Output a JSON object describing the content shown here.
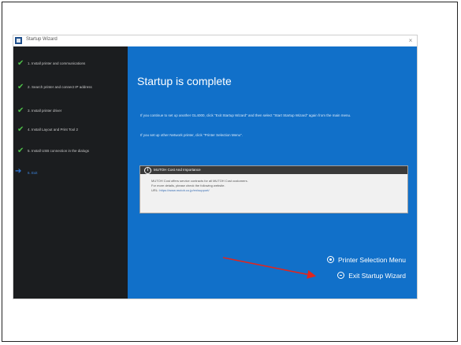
{
  "window": {
    "title": "Startup Wizard",
    "close_glyph": "×"
  },
  "sidebar": {
    "steps": [
      {
        "label": "1. Install printer and communications",
        "state": "done"
      },
      {
        "label": "2. Search printer and connect IP address",
        "state": "done"
      },
      {
        "label": "3. Install printer driver",
        "state": "done"
      },
      {
        "label": "4. Install Layout and Print Tool 2",
        "state": "done"
      },
      {
        "label": "5. Install USB connection in the dialogs",
        "state": "done"
      },
      {
        "label": "6. Exit",
        "state": "current"
      }
    ]
  },
  "main": {
    "title": "Startup is complete",
    "para1": "If you continue to set up another GL4000, click \"Exit Startup Wizard\" and then select \"Start Startup Wizard\" again from the main menu.",
    "para2": "If you set up other Network printer, click \"Printer Selection Menu\"."
  },
  "info": {
    "title": "MUTOH Cost And Importance",
    "lines": [
      "MUTOH Cost offers service contracts for all MUTOH Cost customers.",
      "For more details, please check the following website."
    ],
    "url_label": "URL:",
    "url": "https://www.mutoh.co.jp/en/support/"
  },
  "actions": {
    "printer_selection_label": "Printer Selection Menu",
    "exit_label": "Exit Startup Wizard"
  },
  "colors": {
    "main_bg": "#1170c9",
    "sidebar_bg": "#1b1d1f",
    "check": "#4fc14a",
    "annotation_arrow": "#e0261e"
  },
  "icons": {
    "step_done": "check-icon",
    "step_current": "arrow-right-icon",
    "printer_selection": "circle-dot-icon",
    "exit": "circle-exit-icon",
    "info": "info-icon"
  }
}
